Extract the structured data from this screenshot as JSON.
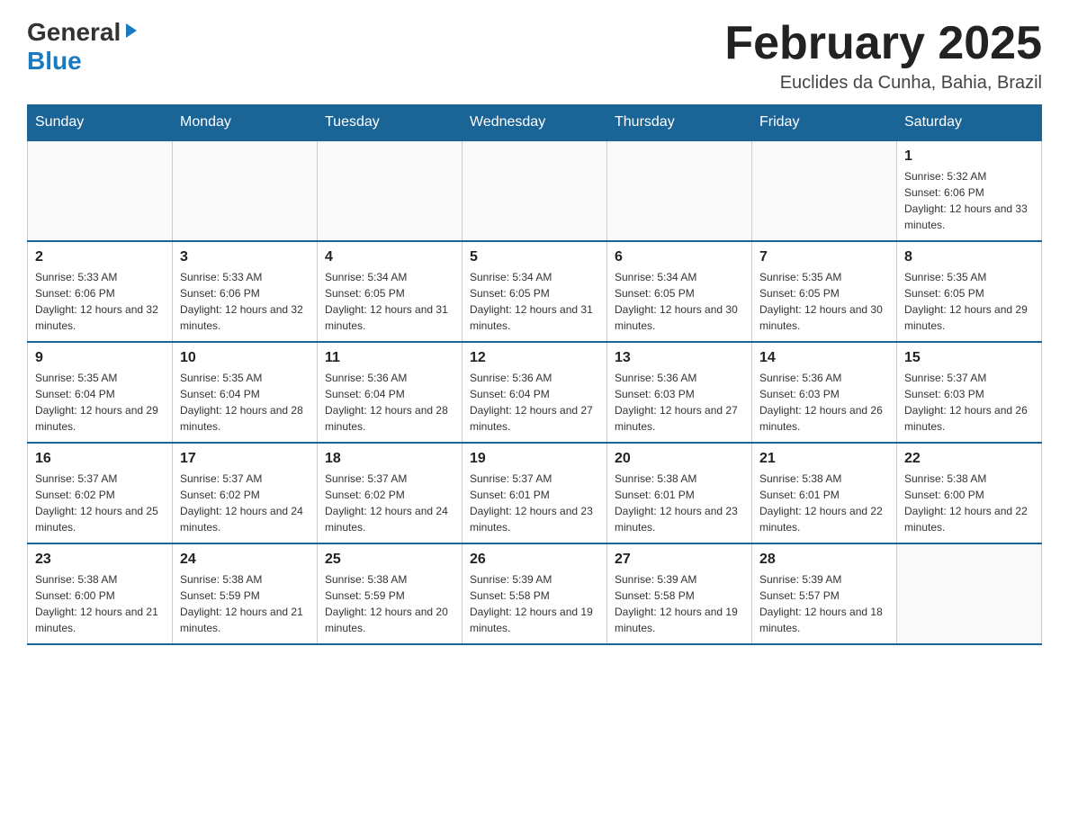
{
  "header": {
    "logo_general": "General",
    "logo_blue": "Blue",
    "month_title": "February 2025",
    "location": "Euclides da Cunha, Bahia, Brazil"
  },
  "weekdays": [
    "Sunday",
    "Monday",
    "Tuesday",
    "Wednesday",
    "Thursday",
    "Friday",
    "Saturday"
  ],
  "weeks": [
    [
      {
        "day": "",
        "info": ""
      },
      {
        "day": "",
        "info": ""
      },
      {
        "day": "",
        "info": ""
      },
      {
        "day": "",
        "info": ""
      },
      {
        "day": "",
        "info": ""
      },
      {
        "day": "",
        "info": ""
      },
      {
        "day": "1",
        "info": "Sunrise: 5:32 AM\nSunset: 6:06 PM\nDaylight: 12 hours and 33 minutes."
      }
    ],
    [
      {
        "day": "2",
        "info": "Sunrise: 5:33 AM\nSunset: 6:06 PM\nDaylight: 12 hours and 32 minutes."
      },
      {
        "day": "3",
        "info": "Sunrise: 5:33 AM\nSunset: 6:06 PM\nDaylight: 12 hours and 32 minutes."
      },
      {
        "day": "4",
        "info": "Sunrise: 5:34 AM\nSunset: 6:05 PM\nDaylight: 12 hours and 31 minutes."
      },
      {
        "day": "5",
        "info": "Sunrise: 5:34 AM\nSunset: 6:05 PM\nDaylight: 12 hours and 31 minutes."
      },
      {
        "day": "6",
        "info": "Sunrise: 5:34 AM\nSunset: 6:05 PM\nDaylight: 12 hours and 30 minutes."
      },
      {
        "day": "7",
        "info": "Sunrise: 5:35 AM\nSunset: 6:05 PM\nDaylight: 12 hours and 30 minutes."
      },
      {
        "day": "8",
        "info": "Sunrise: 5:35 AM\nSunset: 6:05 PM\nDaylight: 12 hours and 29 minutes."
      }
    ],
    [
      {
        "day": "9",
        "info": "Sunrise: 5:35 AM\nSunset: 6:04 PM\nDaylight: 12 hours and 29 minutes."
      },
      {
        "day": "10",
        "info": "Sunrise: 5:35 AM\nSunset: 6:04 PM\nDaylight: 12 hours and 28 minutes."
      },
      {
        "day": "11",
        "info": "Sunrise: 5:36 AM\nSunset: 6:04 PM\nDaylight: 12 hours and 28 minutes."
      },
      {
        "day": "12",
        "info": "Sunrise: 5:36 AM\nSunset: 6:04 PM\nDaylight: 12 hours and 27 minutes."
      },
      {
        "day": "13",
        "info": "Sunrise: 5:36 AM\nSunset: 6:03 PM\nDaylight: 12 hours and 27 minutes."
      },
      {
        "day": "14",
        "info": "Sunrise: 5:36 AM\nSunset: 6:03 PM\nDaylight: 12 hours and 26 minutes."
      },
      {
        "day": "15",
        "info": "Sunrise: 5:37 AM\nSunset: 6:03 PM\nDaylight: 12 hours and 26 minutes."
      }
    ],
    [
      {
        "day": "16",
        "info": "Sunrise: 5:37 AM\nSunset: 6:02 PM\nDaylight: 12 hours and 25 minutes."
      },
      {
        "day": "17",
        "info": "Sunrise: 5:37 AM\nSunset: 6:02 PM\nDaylight: 12 hours and 24 minutes."
      },
      {
        "day": "18",
        "info": "Sunrise: 5:37 AM\nSunset: 6:02 PM\nDaylight: 12 hours and 24 minutes."
      },
      {
        "day": "19",
        "info": "Sunrise: 5:37 AM\nSunset: 6:01 PM\nDaylight: 12 hours and 23 minutes."
      },
      {
        "day": "20",
        "info": "Sunrise: 5:38 AM\nSunset: 6:01 PM\nDaylight: 12 hours and 23 minutes."
      },
      {
        "day": "21",
        "info": "Sunrise: 5:38 AM\nSunset: 6:01 PM\nDaylight: 12 hours and 22 minutes."
      },
      {
        "day": "22",
        "info": "Sunrise: 5:38 AM\nSunset: 6:00 PM\nDaylight: 12 hours and 22 minutes."
      }
    ],
    [
      {
        "day": "23",
        "info": "Sunrise: 5:38 AM\nSunset: 6:00 PM\nDaylight: 12 hours and 21 minutes."
      },
      {
        "day": "24",
        "info": "Sunrise: 5:38 AM\nSunset: 5:59 PM\nDaylight: 12 hours and 21 minutes."
      },
      {
        "day": "25",
        "info": "Sunrise: 5:38 AM\nSunset: 5:59 PM\nDaylight: 12 hours and 20 minutes."
      },
      {
        "day": "26",
        "info": "Sunrise: 5:39 AM\nSunset: 5:58 PM\nDaylight: 12 hours and 19 minutes."
      },
      {
        "day": "27",
        "info": "Sunrise: 5:39 AM\nSunset: 5:58 PM\nDaylight: 12 hours and 19 minutes."
      },
      {
        "day": "28",
        "info": "Sunrise: 5:39 AM\nSunset: 5:57 PM\nDaylight: 12 hours and 18 minutes."
      },
      {
        "day": "",
        "info": ""
      }
    ]
  ]
}
